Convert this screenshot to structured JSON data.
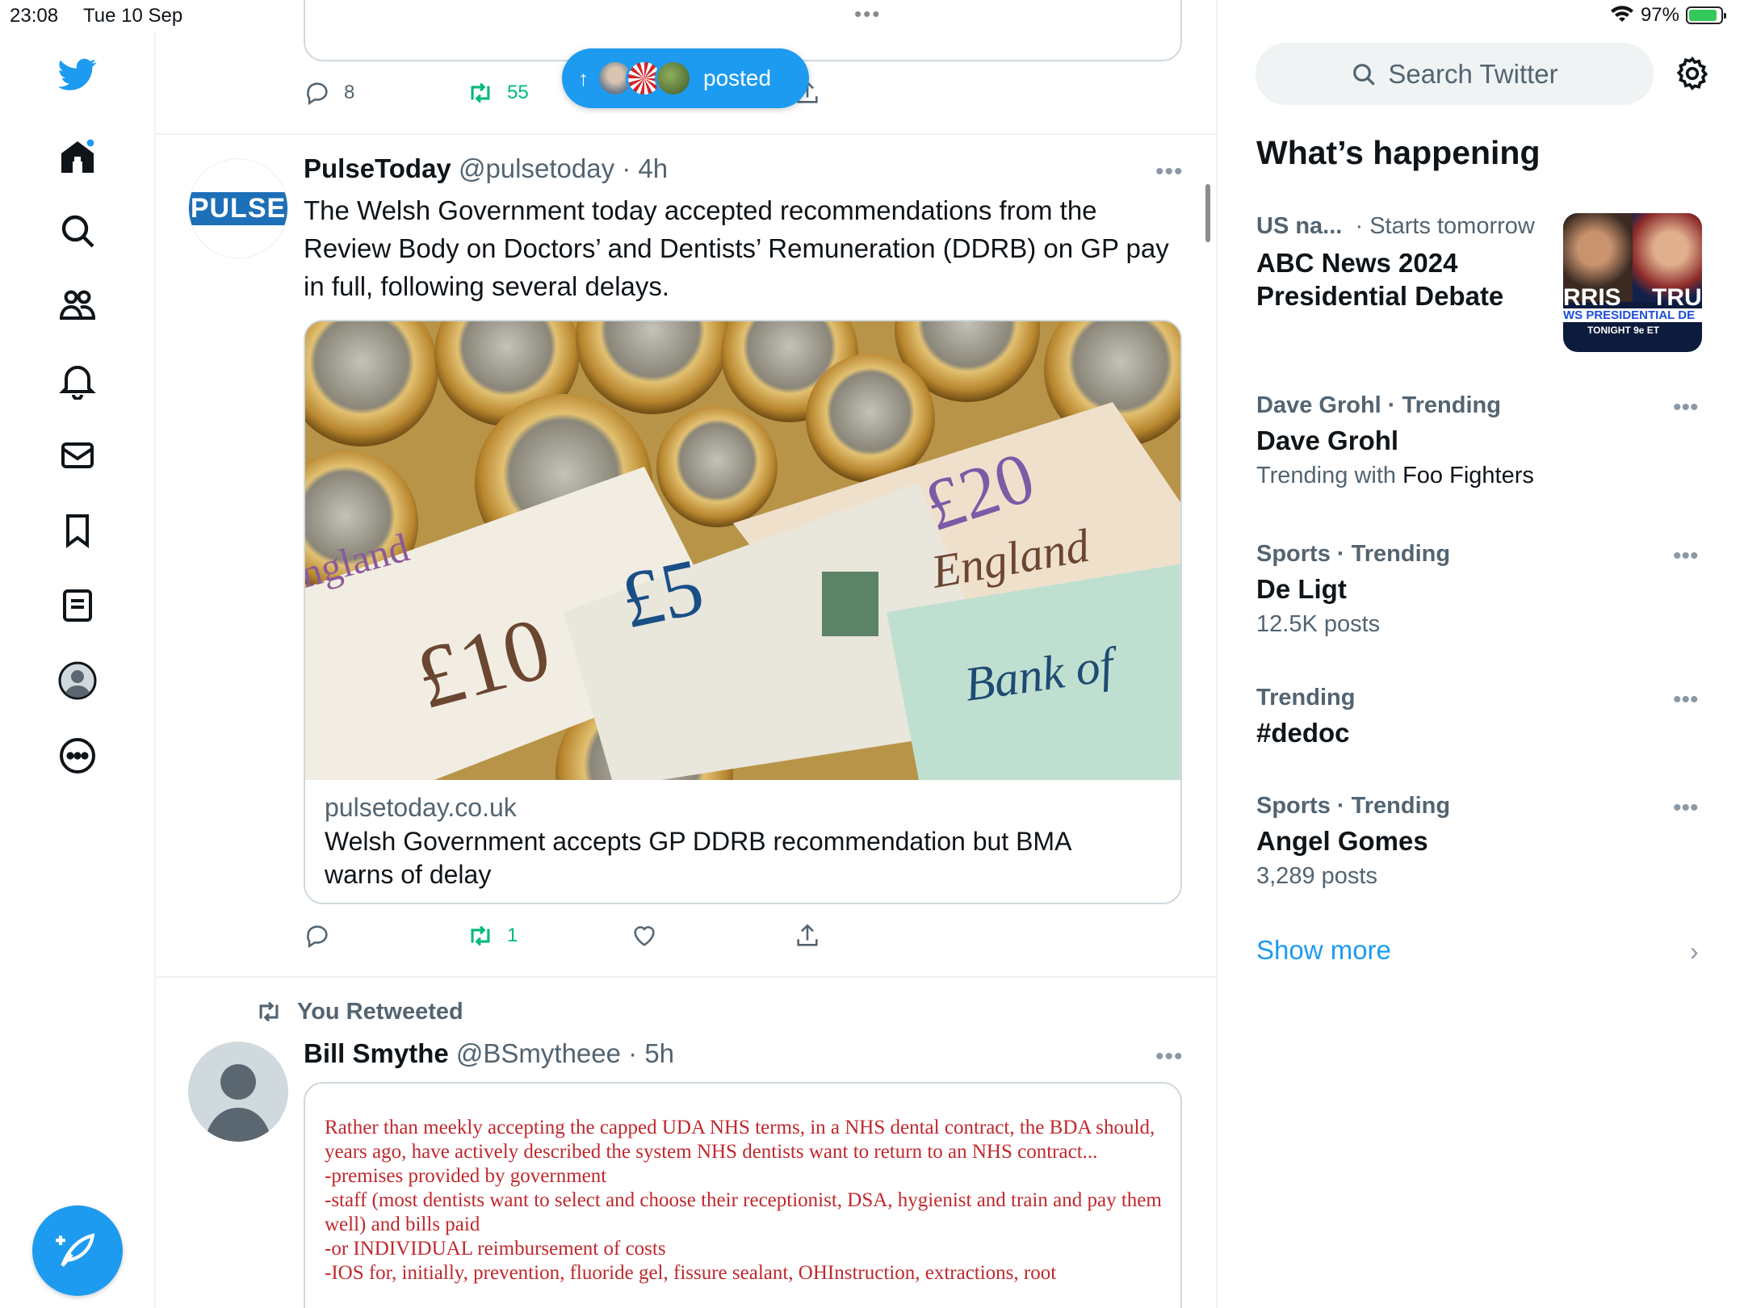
{
  "status": {
    "time": "23:08",
    "date": "Tue 10 Sep",
    "dots": "•••",
    "battery": "97%"
  },
  "nav": {
    "icons": [
      "twitter-logo-icon",
      "home-icon",
      "search-icon",
      "communities-icon",
      "notifications-icon",
      "messages-icon",
      "bookmarks-icon",
      "lists-icon",
      "profile-icon",
      "more-icon"
    ]
  },
  "toast": {
    "label": "posted"
  },
  "top_tweet": {
    "reply_count": "8",
    "retweet_count": "55"
  },
  "tweet1": {
    "avatar_text": "PULSE",
    "name": "PulseToday",
    "handle": "@pulsetoday",
    "time": "· 4h",
    "text": "The Welsh Government today accepted recommendations from the Review Body on Doctors’ and Dentists’ Remuneration (DDRB) on GP pay in full, following several delays.",
    "card_domain": "pulsetoday.co.uk",
    "card_title": "Welsh Government accepts GP DDRB recommendation but BMA warns of delay",
    "retweet_count": "1",
    "more": "•••"
  },
  "tweet2": {
    "retweeted_label": "You Retweeted",
    "name": "Bill Smythe",
    "handle": "@BSmytheee",
    "time": "· 5h",
    "more": "•••",
    "doc_text": "Rather than meekly accepting the capped UDA NHS terms, in a NHS dental contract, the BDA should, years ago, have actively described the system NHS dentists want to return to an NHS contract...\n-premises provided by government\n-staff (most dentists want to select and choose their receptionist, DSA, hygienist and train and pay them well) and bills paid\n-or INDIVIDUAL reimbursement of costs\n-IOS for, initially, prevention, fluoride gel, fissure sealant, OHInstruction, extractions, root"
  },
  "sidebar": {
    "search_placeholder": "Search Twitter",
    "heading": "What’s happening",
    "trends": [
      {
        "category": "US na...",
        "category_suffix": "· Starts tomorrow",
        "topic": "ABC News 2024 Presidential Debate",
        "sub": ""
      },
      {
        "category": "Dave Grohl · Trending",
        "topic": "Dave Grohl",
        "sub_prefix": "Trending with ",
        "sub_highlight": "Foo Fighters"
      },
      {
        "category": "Sports · Trending",
        "topic": "De Ligt",
        "sub": "12.5K posts"
      },
      {
        "category": "Trending",
        "topic": "#dedoc",
        "sub": ""
      },
      {
        "category": "Sports · Trending",
        "topic": "Angel Gomes",
        "sub": "3,289 posts"
      }
    ],
    "thumb_text_1": "RRIS",
    "thumb_text_2": "TRU",
    "thumb_text_3": "WS PRESIDENTIAL DE",
    "thumb_text_4": "TONIGHT 9e ET",
    "more": "•••",
    "show_more": "Show more",
    "chevron": "›"
  },
  "colors": {
    "accent": "#1d9bf0",
    "retweet": "#00ba7c",
    "muted": "#536471",
    "doc_red": "#c0282d"
  }
}
